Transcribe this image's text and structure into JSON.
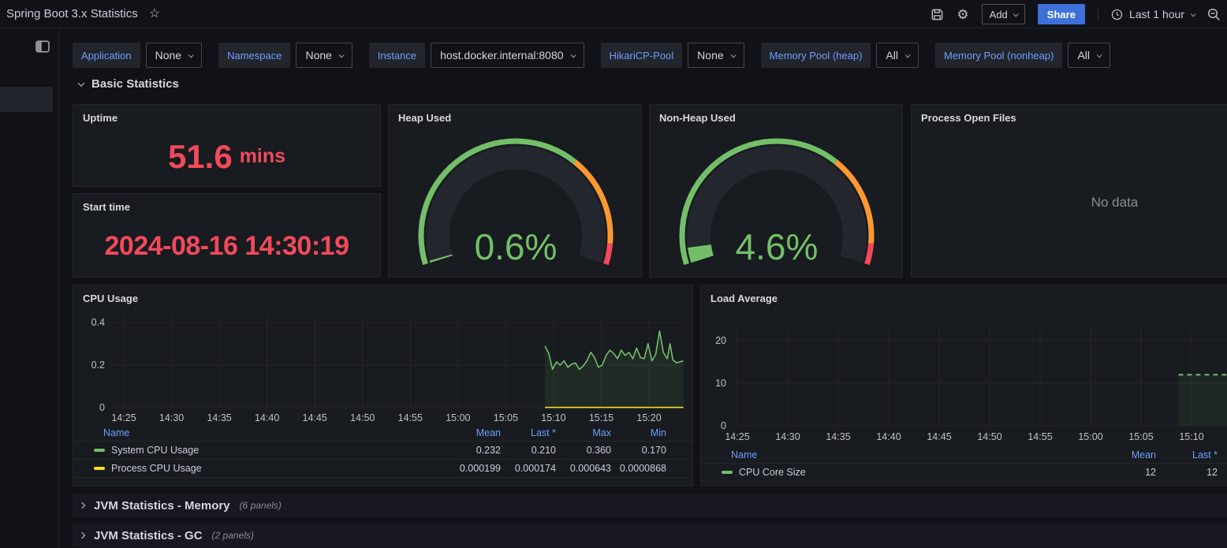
{
  "topbar": {
    "title": "Spring Boot 3.x Statistics",
    "add_label": "Add",
    "share_label": "Share",
    "time_range": "Last 1 hour"
  },
  "filters": [
    {
      "label": "Application",
      "value": "None"
    },
    {
      "label": "Namespace",
      "value": "None"
    },
    {
      "label": "Instance",
      "value": "host.docker.internal:8080"
    },
    {
      "label": "HikariCP-Pool",
      "value": "None"
    },
    {
      "label": "Memory Pool (heap)",
      "value": "All"
    },
    {
      "label": "Memory Pool (nonheap)",
      "value": "All"
    }
  ],
  "section": {
    "title": "Basic Statistics"
  },
  "panels": {
    "uptime": {
      "title": "Uptime",
      "value": "51.6",
      "unit": "mins"
    },
    "start_time": {
      "title": "Start time",
      "value": "2024-08-16 14:30:19"
    },
    "heap": {
      "title": "Heap Used",
      "value_pct": 0.6,
      "display": "0.6%"
    },
    "nonheap": {
      "title": "Non-Heap Used",
      "value_pct": 4.6,
      "display": "4.6%"
    },
    "open_files": {
      "title": "Process Open Files",
      "no_data": "No data"
    },
    "cpu": {
      "title": "CPU Usage"
    },
    "load": {
      "title": "Load Average"
    }
  },
  "gauge_style": {
    "start_deg": 197.5,
    "end_deg": -17.5,
    "track_color": "#23262d",
    "value_color": "#73BF69",
    "thresholds": [
      {
        "frac": 0.68,
        "color": "#73BF69"
      },
      {
        "frac": 0.94,
        "color": "#FF9830"
      },
      {
        "frac": 1.0,
        "color": "#F2495C"
      }
    ]
  },
  "chart_data": [
    {
      "type": "line",
      "title": "CPU Usage",
      "x_axis": {
        "note": "t = minutes after 14:25, range shown is Last 1 hour",
        "ticks": [
          {
            "t": 0,
            "label": "14:25"
          },
          {
            "t": 5,
            "label": "14:30"
          },
          {
            "t": 10,
            "label": "14:35"
          },
          {
            "t": 15,
            "label": "14:40"
          },
          {
            "t": 20,
            "label": "14:45"
          },
          {
            "t": 25,
            "label": "14:50"
          },
          {
            "t": 30,
            "label": "14:55"
          },
          {
            "t": 35,
            "label": "15:00"
          },
          {
            "t": 40,
            "label": "15:05"
          },
          {
            "t": 45,
            "label": "15:10"
          },
          {
            "t": 50,
            "label": "15:15"
          },
          {
            "t": 55,
            "label": "15:20"
          }
        ]
      },
      "y_axis": {
        "range": [
          0,
          0.44
        ],
        "ticks": [
          {
            "v": 0,
            "label": "0"
          },
          {
            "v": 0.2,
            "label": "0.2"
          },
          {
            "v": 0.4,
            "label": "0.4"
          }
        ]
      },
      "series": [
        {
          "name": "System CPU Usage",
          "color": "#73BF69",
          "fill_opacity": 0.1,
          "dash": null,
          "points": [
            [
              44.1,
              0.29
            ],
            [
              44.5,
              0.255
            ],
            [
              44.9,
              0.18
            ],
            [
              45.3,
              0.215
            ],
            [
              45.7,
              0.2
            ],
            [
              46.1,
              0.22
            ],
            [
              46.5,
              0.19
            ],
            [
              46.9,
              0.205
            ],
            [
              47.3,
              0.21
            ],
            [
              47.7,
              0.18
            ],
            [
              48.1,
              0.195
            ],
            [
              48.5,
              0.22
            ],
            [
              48.9,
              0.26
            ],
            [
              49.3,
              0.235
            ],
            [
              49.7,
              0.19
            ],
            [
              50.1,
              0.2
            ],
            [
              50.5,
              0.245
            ],
            [
              50.9,
              0.27
            ],
            [
              51.3,
              0.255
            ],
            [
              51.7,
              0.23
            ],
            [
              52.1,
              0.27
            ],
            [
              52.5,
              0.245
            ],
            [
              52.9,
              0.26
            ],
            [
              53.3,
              0.23
            ],
            [
              53.7,
              0.28
            ],
            [
              54.1,
              0.235
            ],
            [
              54.5,
              0.23
            ],
            [
              54.9,
              0.3
            ],
            [
              55.3,
              0.22
            ],
            [
              55.7,
              0.25
            ],
            [
              56.1,
              0.36
            ],
            [
              56.5,
              0.26
            ],
            [
              56.9,
              0.23
            ],
            [
              57.2,
              0.3
            ],
            [
              57.5,
              0.225
            ],
            [
              57.9,
              0.21
            ],
            [
              58.2,
              0.215
            ],
            [
              58.6,
              0.22
            ]
          ]
        },
        {
          "name": "Process CPU Usage",
          "color": "#FADE2A",
          "fill_opacity": 0,
          "dash": null,
          "points": [
            [
              44.1,
              0.001
            ],
            [
              58.6,
              0.001
            ]
          ]
        }
      ],
      "legend": {
        "name_header": "Name",
        "columns": [
          "Mean",
          "Last *",
          "Max",
          "Min"
        ],
        "rows": [
          {
            "name": "System CPU Usage",
            "color": "#73BF69",
            "values": [
              "0.232",
              "0.210",
              "0.360",
              "0.170"
            ]
          },
          {
            "name": "Process CPU Usage",
            "color": "#FADE2A",
            "values": [
              "0.000199",
              "0.000174",
              "0.000643",
              "0.0000868"
            ]
          }
        ]
      }
    },
    {
      "type": "line",
      "title": "Load Average",
      "x_axis": {
        "note": "t = minutes after 14:25",
        "ticks": [
          {
            "t": 0,
            "label": "14:25"
          },
          {
            "t": 5,
            "label": "14:30"
          },
          {
            "t": 10,
            "label": "14:35"
          },
          {
            "t": 15,
            "label": "14:40"
          },
          {
            "t": 20,
            "label": "14:45"
          },
          {
            "t": 25,
            "label": "14:50"
          },
          {
            "t": 30,
            "label": "14:55"
          },
          {
            "t": 35,
            "label": "15:00"
          },
          {
            "t": 40,
            "label": "15:05"
          },
          {
            "t": 45,
            "label": "15:10"
          }
        ]
      },
      "y_axis": {
        "range": [
          0,
          22.8
        ],
        "ticks": [
          {
            "v": 0,
            "label": "0"
          },
          {
            "v": 10,
            "label": "10"
          },
          {
            "v": 20,
            "label": "20"
          }
        ]
      },
      "series": [
        {
          "name": "CPU Core Size",
          "color": "#73BF69",
          "fill_opacity": 0.08,
          "dash": [
            6,
            5
          ],
          "points": [
            [
              43.7,
              12
            ],
            [
              57,
              12
            ]
          ]
        }
      ],
      "legend": {
        "name_header": "Name",
        "columns": [
          "Mean",
          "Last *"
        ],
        "rows": [
          {
            "name": "CPU Core Size",
            "color": "#73BF69",
            "values": [
              "12",
              "12"
            ]
          }
        ]
      }
    }
  ],
  "rows": [
    {
      "title": "JVM Statistics - Memory",
      "count": "(6 panels)"
    },
    {
      "title": "JVM Statistics - GC",
      "count": "(2 panels)"
    }
  ],
  "colors": {
    "accent_blue": "#6E9FFF",
    "primary_button": "#3D71D9",
    "stat_red": "#F2495C",
    "green": "#73BF69",
    "yellow": "#FADE2A",
    "orange": "#FF9830"
  }
}
